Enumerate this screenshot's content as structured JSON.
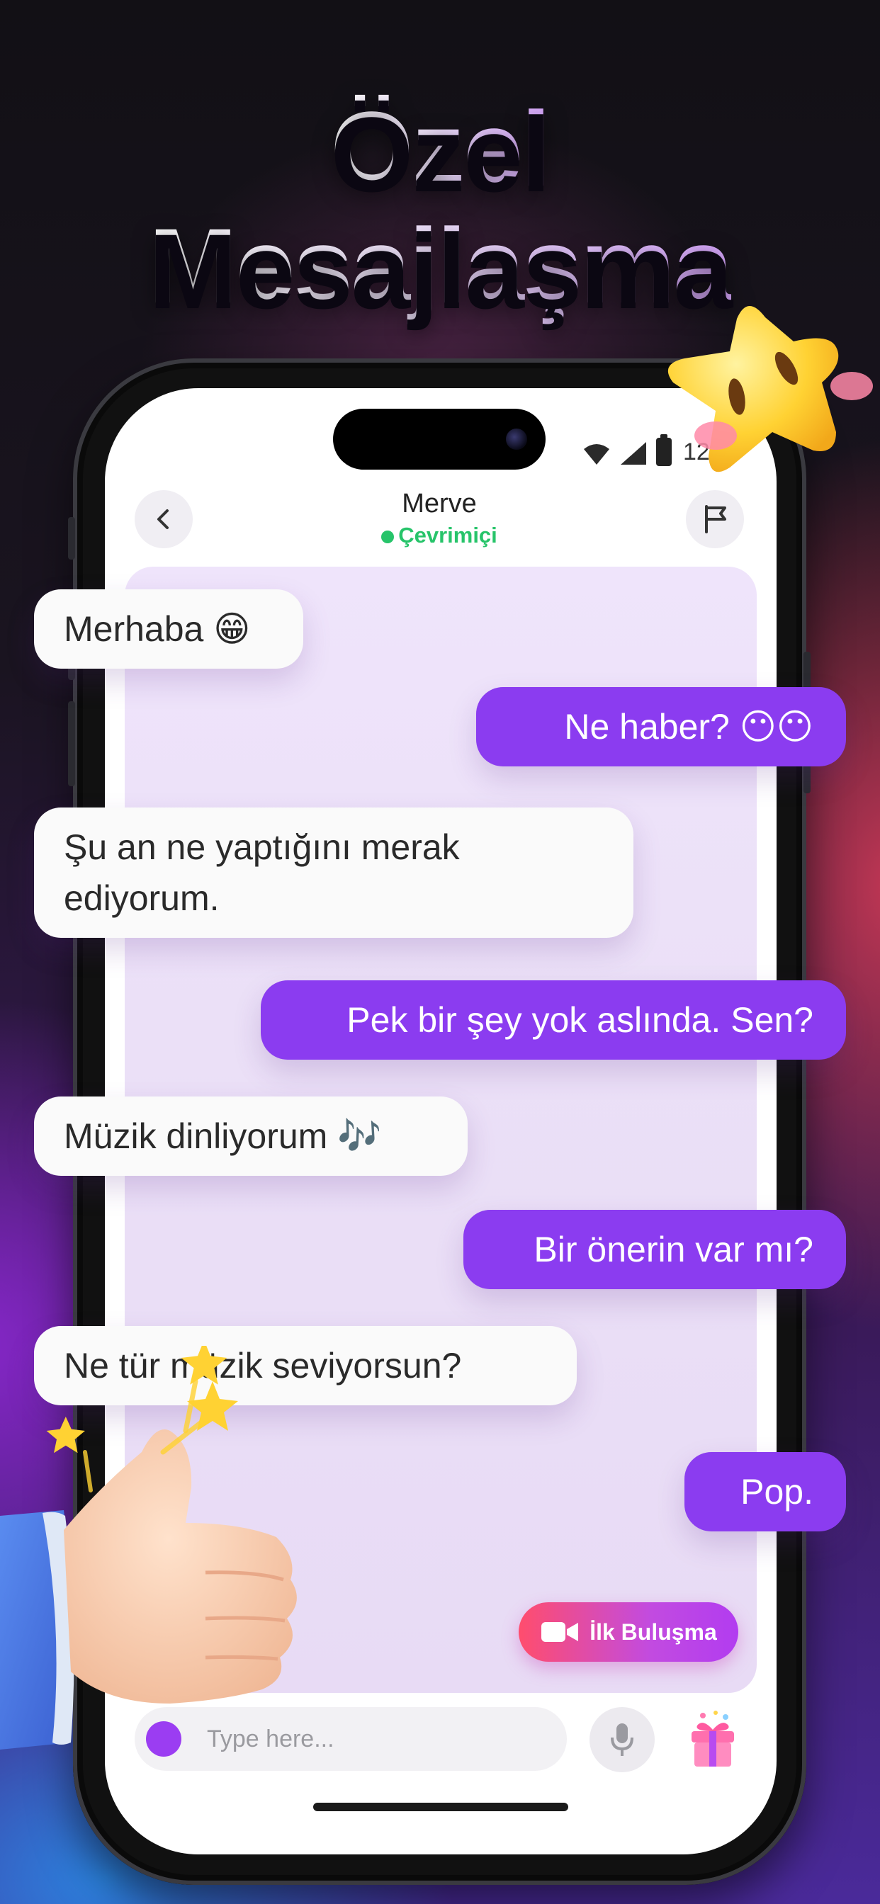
{
  "headline": {
    "line1": "Özel",
    "line2": "Mesajlaşma"
  },
  "status_bar": {
    "time": "12"
  },
  "chat_header": {
    "name": "Merve",
    "status": "Çevrimiçi"
  },
  "messages": [
    {
      "side": "in",
      "text": "Merhaba 😁"
    },
    {
      "side": "out",
      "text": "Ne haber? 😶😶"
    },
    {
      "side": "in",
      "text": "Şu an ne yaptığını merak ediyorum."
    },
    {
      "side": "out",
      "text": "Pek bir şey yok aslında. Sen?"
    },
    {
      "side": "in",
      "text": "Müzik dinliyorum 🎶"
    },
    {
      "side": "out",
      "text": "Bir önerin var mı?"
    },
    {
      "side": "in",
      "text": "Ne tür müzik seviyorsun?"
    },
    {
      "side": "out",
      "text": "Pop."
    }
  ],
  "first_meeting_button": {
    "label": "İlk Buluşma",
    "icon": "video-camera-icon"
  },
  "composer": {
    "placeholder": "Type here...",
    "mic_icon": "microphone-icon",
    "gift_icon": "gift-icon"
  },
  "colors": {
    "accent": "#8b3cf0",
    "online": "#27c46a",
    "meet_gradient_start": "#ff4d6d",
    "meet_gradient_end": "#b23cf0"
  }
}
